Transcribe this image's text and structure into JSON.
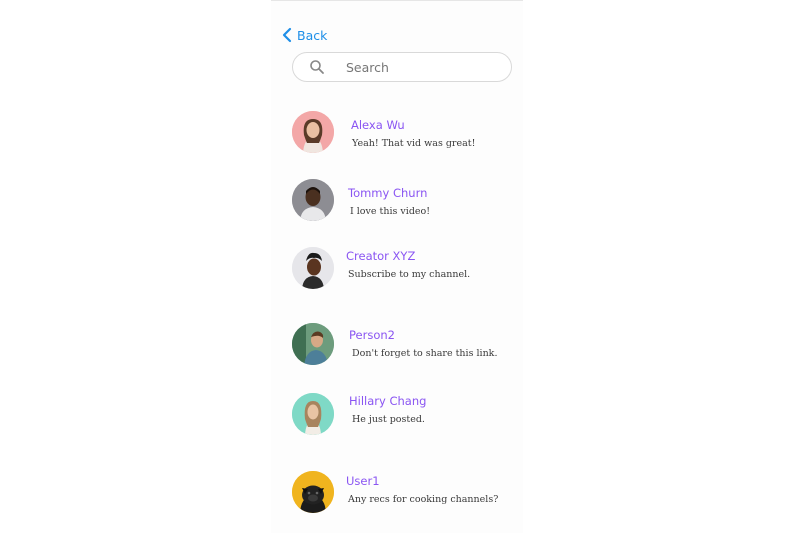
{
  "nav": {
    "back_label": "Back"
  },
  "search": {
    "placeholder": "Search"
  },
  "colors": {
    "accent": "#1e8fe8",
    "name": "#8a55f2"
  },
  "chats": [
    {
      "name": "Alexa Wu",
      "message": "Yeah! That vid was great!",
      "avatar_bg": "#f3a7a7"
    },
    {
      "name": "Tommy Churn",
      "message": "I love this video!",
      "avatar_bg": "#8d8d93"
    },
    {
      "name": "Creator XYZ",
      "message": "Subscribe to my channel.",
      "avatar_bg": "#e6e6ea"
    },
    {
      "name": "Person2",
      "message": "Don't forget to share this link.",
      "avatar_bg": "#4b8a6b"
    },
    {
      "name": "Hillary Chang",
      "message": "He just posted.",
      "avatar_bg": "#7fd9c6"
    },
    {
      "name": "User1",
      "message": "Any recs for cooking channels?",
      "avatar_bg": "#f0b41e"
    }
  ]
}
